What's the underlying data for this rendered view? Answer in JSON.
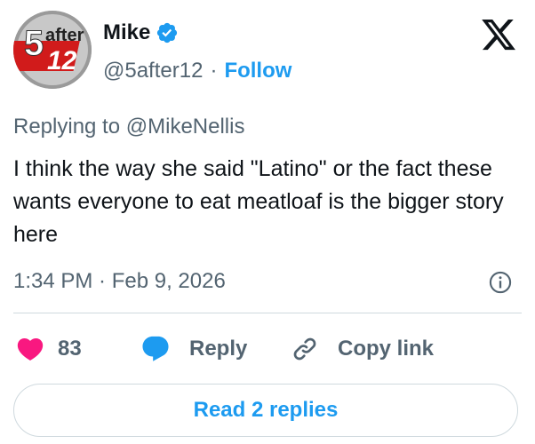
{
  "author": {
    "name": "Mike",
    "handle": "@5after12",
    "separator": "·",
    "follow_label": "Follow",
    "avatar_text_top": "after",
    "avatar_text_big": "5",
    "avatar_text_num": "12"
  },
  "tweet": {
    "replying_prefix": "Replying to",
    "replying_to": "@MikeNellis",
    "text": "I think the way she said \"Latino\" or the fact these wants everyone to eat meatloaf is the bigger story here",
    "timestamp": "1:34 PM · Feb 9, 2026"
  },
  "actions": {
    "likes": "83",
    "reply_label": "Reply",
    "copy_label": "Copy link",
    "read_replies_label": "Read 2 replies"
  },
  "colors": {
    "accent": "#1d9bf0",
    "like": "#f91880",
    "muted": "#536471",
    "text": "#0f1419",
    "border": "#cfd9de"
  },
  "icons": [
    "x-logo-icon",
    "verified-badge-icon",
    "info-icon",
    "heart-icon",
    "reply-bubble-icon",
    "link-icon"
  ]
}
